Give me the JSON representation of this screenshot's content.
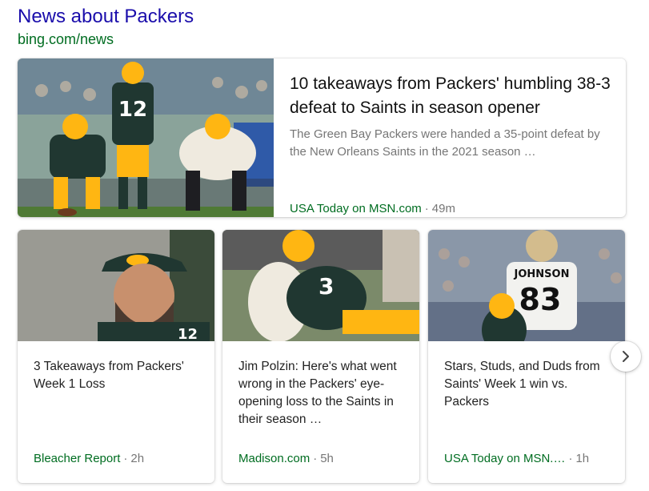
{
  "header": {
    "title": "News about Packers",
    "source": "bing.com/news"
  },
  "feature": {
    "headline": "10 takeaways from Packers' humbling 38-3 defeat to Saints in season opener",
    "snippet": "The Green Bay Packers were handed a 35-point defeat by the New Orleans Saints in the 2021 season …",
    "provider": "USA Today on MSN.com",
    "separator": "·",
    "age": "49m",
    "image_jersey_number": "12"
  },
  "cards": [
    {
      "headline": "3 Takeaways from Packers' Week 1 Loss",
      "provider": "Bleacher Report",
      "separator": "·",
      "age": "2h",
      "image_jersey_number": "12"
    },
    {
      "headline": "Jim Polzin: Here's what went wrong in the Packers' eye-opening loss to the Saints in their season …",
      "provider": "Madison.com",
      "separator": "·",
      "age": "5h",
      "image_jersey_number": "3"
    },
    {
      "headline": "Stars, Studs, and Duds from Saints' Week 1 win vs. Packers",
      "provider": "USA Today on MSN.…",
      "separator": "·",
      "age": "1h",
      "image_jersey_name": "JOHNSON",
      "image_jersey_number": "83"
    }
  ],
  "colors": {
    "title_link": "#1a0dab",
    "source_green": "#006d21",
    "meta_gray": "#767676",
    "packers_green": "#203731",
    "packers_gold": "#ffb612",
    "saints_gold": "#d3bc8d"
  },
  "icons": {
    "next": "chevron-right-icon"
  }
}
